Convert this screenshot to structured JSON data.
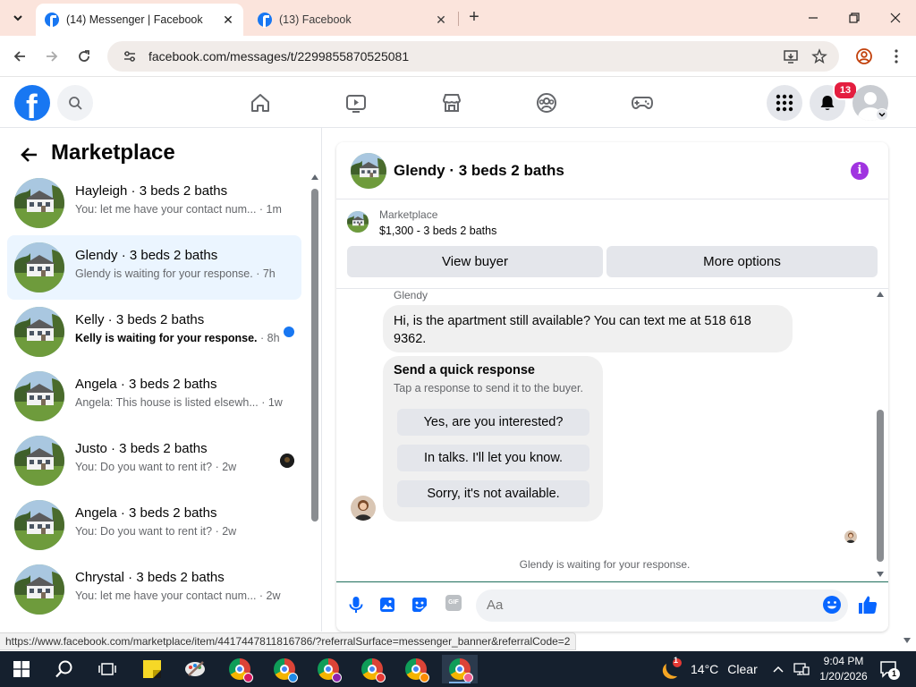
{
  "browser": {
    "tabs": [
      {
        "title": "(14) Messenger | Facebook",
        "active": true
      },
      {
        "title": "(13) Facebook",
        "active": false
      }
    ],
    "url": "facebook.com/messages/t/2299855870525081",
    "status_url": "https://www.facebook.com/marketplace/item/4417447811816786/?referralSurface=messenger_banner&referralCode=2"
  },
  "fb_header": {
    "logo_letter": "f",
    "notification_count": "13"
  },
  "left_panel": {
    "title": "Marketplace",
    "conversations": [
      {
        "name": "Hayleigh · 3 beds 2 baths",
        "snippet": "You: let me have your contact num...",
        "time": " · 1m",
        "unread": false,
        "selected": false,
        "indicator": "none"
      },
      {
        "name": "Glendy · 3 beds 2 baths",
        "snippet": "Glendy is waiting for your response.",
        "time": " · 7h",
        "unread": false,
        "selected": true,
        "indicator": "none"
      },
      {
        "name": "Kelly · 3 beds 2 baths",
        "snippet": "Kelly is waiting for your response.",
        "time": " · 8h",
        "unread": true,
        "selected": false,
        "indicator": "unread-dot"
      },
      {
        "name": "Angela · 3 beds 2 baths",
        "snippet": "Angela: This house is listed elsewh...",
        "time": " · 1w",
        "unread": false,
        "selected": false,
        "indicator": "none"
      },
      {
        "name": "Justo · 3 beds 2 baths",
        "snippet": "You: Do you want to rent it?",
        "time": " · 2w",
        "unread": false,
        "selected": false,
        "indicator": "seen-avatar"
      },
      {
        "name": "Angela · 3 beds 2 baths",
        "snippet": "You: Do you want to rent it?",
        "time": " · 2w",
        "unread": false,
        "selected": false,
        "indicator": "none"
      },
      {
        "name": "Chrystal · 3 beds 2 baths",
        "snippet": "You: let me have your contact num...",
        "time": " · 2w",
        "unread": false,
        "selected": false,
        "indicator": "none"
      }
    ]
  },
  "chat": {
    "title": "Glendy · 3 beds 2 baths",
    "marketplace_label": "Marketplace",
    "listing": "$1,300 - 3 beds 2 baths",
    "view_buyer": "View buyer",
    "more_options": "More options",
    "sender_name": "Glendy",
    "message": "Hi, is the apartment still available? You can text me at 518 618 9362.",
    "quick_response": {
      "title": "Send a quick response",
      "subtitle": "Tap a response to send it to the buyer.",
      "options": [
        "Yes, are you interested?",
        "In talks. I'll let you know.",
        "Sorry, it's not available."
      ]
    },
    "waiting_notice": "Glendy is waiting for your response.",
    "composer_placeholder": "Aa",
    "gif_label": "GIF"
  },
  "taskbar": {
    "weather_temp": "14°C",
    "weather_desc": "Clear",
    "weather_badge": "1",
    "time": "9:04 PM",
    "date": "1/20/2026",
    "notification_count": "1"
  },
  "colors": {
    "fb_blue": "#1877f2",
    "selected_row": "#ebf5ff",
    "info_purple": "#a033e0",
    "badge_red": "#e41e3f",
    "tab_strip": "#fbe4dc"
  }
}
